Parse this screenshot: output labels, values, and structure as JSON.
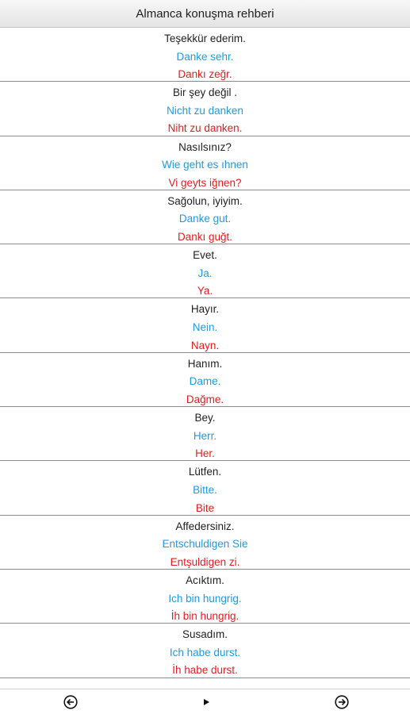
{
  "app": {
    "title": "Almanca konuşma rehberi"
  },
  "phrases": [
    {
      "turkish": "Teşekkür ederim.",
      "german": "Danke sehr.",
      "pronunciation": "Dankı zeğr."
    },
    {
      "turkish": "Bir şey değil .",
      "german": "Nicht zu danken",
      "pronunciation": "Niht zu danken."
    },
    {
      "turkish": "Nasılsınız?",
      "german": "Wie geht es ıhnen",
      "pronunciation": "Vi geyts iğnen?"
    },
    {
      "turkish": "Sağolun, iyiyim.",
      "german": "Danke gut.",
      "pronunciation": "Dankı guğt."
    },
    {
      "turkish": "Evet.",
      "german": "Ja.",
      "pronunciation": "Ya."
    },
    {
      "turkish": "Hayır.",
      "german": "Nein.",
      "pronunciation": "Nayn."
    },
    {
      "turkish": "Hanım.",
      "german": "Dame.",
      "pronunciation": "Dağme."
    },
    {
      "turkish": "Bey.",
      "german": "Herr.",
      "pronunciation": "Her."
    },
    {
      "turkish": "Lütfen.",
      "german": "Bitte.",
      "pronunciation": "Bite"
    },
    {
      "turkish": "Affedersiniz.",
      "german": "Entschuldigen Sie",
      "pronunciation": "Entşuldigen zi."
    },
    {
      "turkish": "Acıktım.",
      "german": "Ich bin hungrig.",
      "pronunciation": "İh bin hungrig."
    },
    {
      "turkish": "Susadım.",
      "german": "Ich habe durst.",
      "pronunciation": "İh habe durst."
    }
  ],
  "colors": {
    "turkish_text": "#222222",
    "german_text": "#1e9be0",
    "pronunciation_text": "#e11e1e",
    "divider": "#8c8c8c"
  },
  "controls": {
    "previous_icon": "circled-arrow-left-icon",
    "play_icon": "play-icon",
    "next_icon": "circled-arrow-right-icon"
  }
}
